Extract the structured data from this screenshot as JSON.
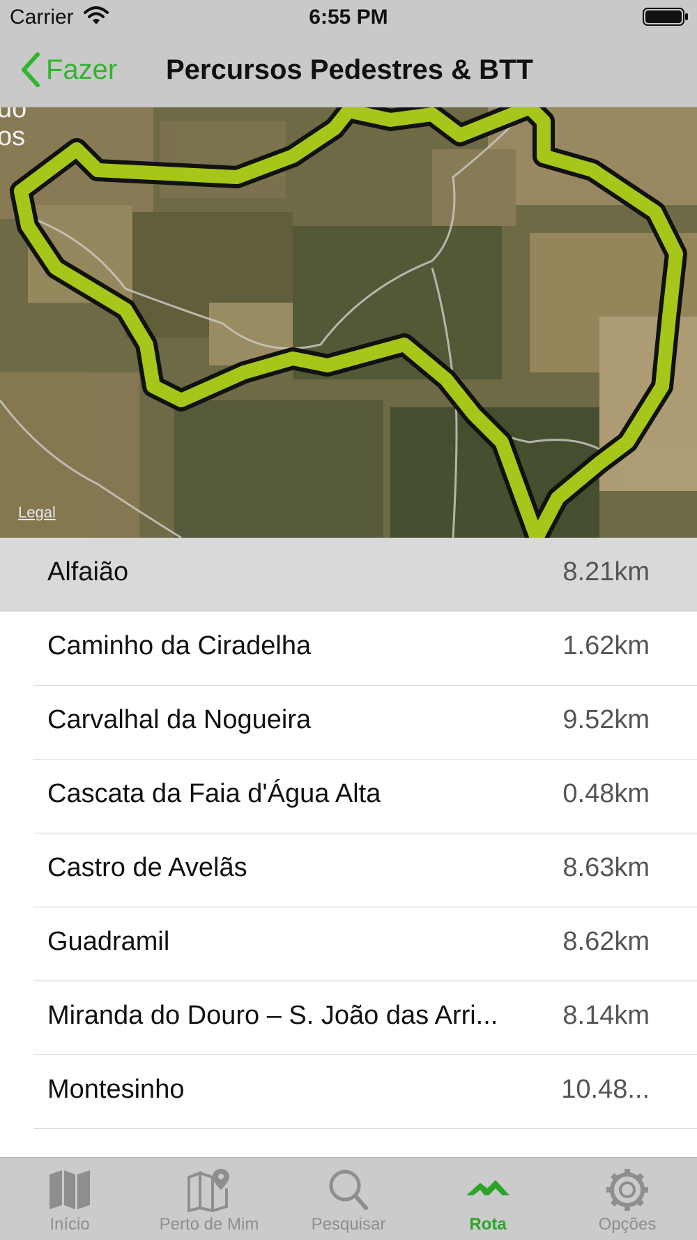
{
  "status_bar": {
    "carrier": "Carrier",
    "time": "6:55 PM"
  },
  "nav": {
    "back_label": "Fazer",
    "title": "Percursos Pedestres & BTT"
  },
  "map": {
    "label": "do\nos",
    "legal": "Legal",
    "route_color": "#a7c61a"
  },
  "routes": [
    {
      "name": "Alfaião",
      "distance": "8.21km",
      "selected": true
    },
    {
      "name": "Caminho da Ciradelha",
      "distance": "1.62km"
    },
    {
      "name": "Carvalhal da Nogueira",
      "distance": "9.52km"
    },
    {
      "name": "Cascata da Faia d'Água Alta",
      "distance": "0.48km"
    },
    {
      "name": "Castro de Avelãs",
      "distance": "8.63km"
    },
    {
      "name": "Guadramil",
      "distance": "8.62km"
    },
    {
      "name": "Miranda do Douro – S. João das Arri...",
      "distance": "8.14km"
    },
    {
      "name": "Montesinho",
      "distance": "10.48..."
    }
  ],
  "tabs": [
    {
      "label": "Início",
      "icon": "map-book-icon",
      "active": false
    },
    {
      "label": "Perto de Mim",
      "icon": "map-pin-icon",
      "active": false
    },
    {
      "label": "Pesquisar",
      "icon": "search-icon",
      "active": false
    },
    {
      "label": "Rota",
      "icon": "mountain-route-icon",
      "active": true
    },
    {
      "label": "Opções",
      "icon": "gear-icon",
      "active": false
    }
  ],
  "colors": {
    "accent": "#2fb52a",
    "tab_active": "#2aa52a",
    "tab_inactive": "#8e8e8e",
    "bar_background": "#c9c9c9"
  }
}
